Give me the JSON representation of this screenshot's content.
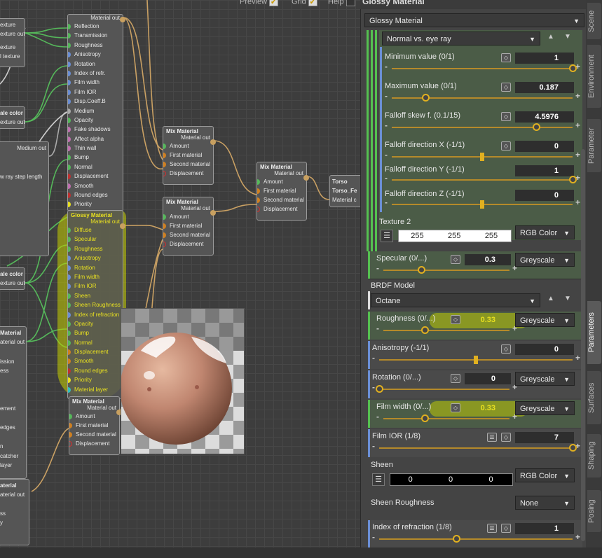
{
  "topbar": {
    "preview": "Preview",
    "grid": "Grid",
    "help": "Help",
    "title": "Glossy Material",
    "check": "✓"
  },
  "graph": {
    "left_frags": [
      {
        "text": "exture"
      },
      {
        "text": "exture out"
      },
      {
        "text": "exture"
      },
      {
        "text": "l texture"
      },
      {
        "text": "ale color"
      },
      {
        "text": "exture out"
      },
      {
        "text": "Medium out"
      },
      {
        "text": "w ray step length"
      },
      {
        "text": "ale color"
      },
      {
        "text": "exture out"
      },
      {
        "text": "Material"
      },
      {
        "text": "aterial out"
      },
      {
        "text": "ission"
      },
      {
        "text": "ess"
      },
      {
        "text": "ement"
      },
      {
        "text": "edges"
      },
      {
        "text": "n"
      },
      {
        "text": "catcher"
      },
      {
        "text": "layer"
      },
      {
        "text": "aterial"
      },
      {
        "text": "aterial out"
      },
      {
        "text": "ss"
      },
      {
        "text": "y"
      }
    ],
    "top_node": {
      "out": "Material out",
      "ports": [
        "Reflection",
        "Transmission",
        "Roughness",
        "Anisotropy",
        "Rotation",
        "Index of refr.",
        "Film width",
        "Film IOR",
        "Disp.Coeff.B",
        "Medium",
        "Opacity",
        "Fake shadows",
        "Affect alpha",
        "Thin wall",
        "Bump",
        "Normal",
        "Displacement",
        "Smooth",
        "Round edges",
        "Priority"
      ]
    },
    "glossy_node": {
      "title": "Glossy Material",
      "out": "Material out",
      "ports": [
        "Diffuse",
        "Specular",
        "Roughness",
        "Anisotropy",
        "Rotation",
        "Film width",
        "Film IOR",
        "Sheen",
        "Sheen Roughness",
        "Index of refraction",
        "Opacity",
        "Bump",
        "Normal",
        "Displacement",
        "Smooth",
        "Round edges",
        "Priority",
        "Material layer"
      ]
    },
    "mix_nodes": [
      {
        "title": "Mix Material",
        "out": "Material out",
        "ports": [
          "Amount",
          "First material",
          "Second material",
          "Displacement"
        ]
      },
      {
        "title": "Mix Material",
        "out": "Material out",
        "ports": [
          "Amount",
          "First material",
          "Second material",
          "Displacement"
        ]
      },
      {
        "title": "Mix Material",
        "out": "Material out",
        "ports": [
          "Amount",
          "First material",
          "Second material",
          "Displacement"
        ]
      },
      {
        "title": "Mix Material",
        "out": "Material out",
        "ports": [
          "Amount",
          "First material",
          "Second material",
          "Displacement"
        ]
      }
    ],
    "torso_node": {
      "lines": [
        "Torso",
        "Torso_Fe",
        "Material c"
      ]
    }
  },
  "panel": {
    "material_select": "Glossy Material",
    "normal_select": "Normal vs. eye ray",
    "min_label": "Minimum value (0/1)",
    "min_val": "1",
    "min_pos": 1.0,
    "max_label": "Maximum value (0/1)",
    "max_val": "0.187",
    "max_pos": 0.187,
    "skew_label": "Falloff skew f. (0.1/15)",
    "skew_val": "4.5976",
    "skew_pos": 0.8,
    "fx_label": "Falloff direction X (-1/1)",
    "fx_val": "0",
    "fx_pos": 0.5,
    "fy_label": "Falloff direction Y (-1/1)",
    "fy_val": "1",
    "fy_pos": 1.0,
    "fz_label": "Falloff direction Z (-1/1)",
    "fz_val": "0",
    "fz_pos": 0.5,
    "tex2_label": "Texture 2",
    "tex2_rgb": [
      "255",
      "255",
      "255"
    ],
    "tex2_mode": "RGB Color",
    "spec_label": "Specular (0/...)",
    "spec_val": "0.3",
    "spec_pos": 0.3,
    "spec_mode": "Greyscale",
    "brdf_label": "BRDF Model",
    "brdf_select": "Octane",
    "rough_label": "Roughness (0/...)",
    "rough_val": "0.33",
    "rough_pos": 0.33,
    "rough_mode": "Greyscale",
    "aniso_label": "Anisotropy (-1/1)",
    "aniso_val": "0",
    "aniso_pos": 0.5,
    "rot_label": "Rotation (0/...)",
    "rot_val": "0",
    "rot_pos": 0.0,
    "rot_mode": "Greyscale",
    "film_label": "Film width (0/...)",
    "film_val": "0.33",
    "film_pos": 0.33,
    "film_mode": "Greyscale",
    "filmior_label": "Film IOR (1/8)",
    "filmior_val": "7",
    "filmior_pos": 1.0,
    "sheen_label": "Sheen",
    "sheen_rgb": [
      "0",
      "0",
      "0"
    ],
    "sheen_mode": "RGB Color",
    "sheenr_label": "Sheen Roughness",
    "sheenr_mode": "None",
    "ior_label": "Index of refraction (1/8)",
    "ior_val": "1",
    "ior_pos": 0.4
  },
  "rtabs": [
    "Scene",
    "Environment",
    "Parameter",
    "Parameters",
    "Surfaces",
    "Shaping",
    "Posing"
  ],
  "symbols": {
    "up": "▲",
    "down": "▼",
    "minus": "-",
    "plus": "+",
    "key": "◇",
    "list": "☰",
    "arrow": "▼"
  },
  "colors": {
    "accent": "#e0b020",
    "highlight": "#c8d200",
    "green_bar": "#55c050",
    "blue_bar": "#6b8fd6"
  }
}
